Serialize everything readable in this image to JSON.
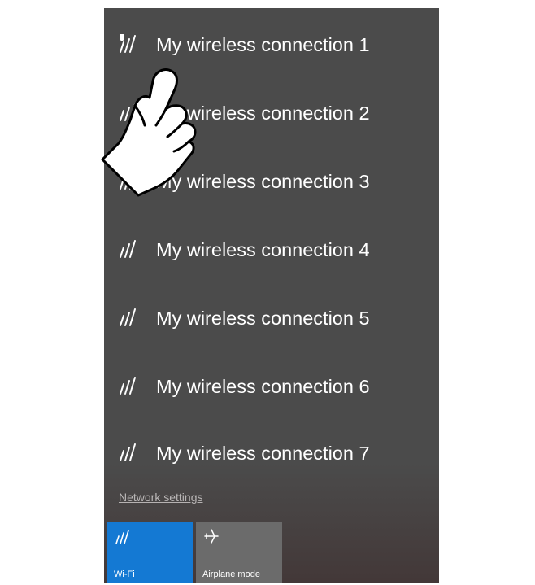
{
  "networks": [
    {
      "label": "My wireless connection 1",
      "icon": "wifi-secured-icon"
    },
    {
      "label": "My wireless connection 2",
      "icon": "wifi-icon"
    },
    {
      "label": "My wireless connection 3",
      "icon": "wifi-icon"
    },
    {
      "label": "My wireless connection 4",
      "icon": "wifi-icon"
    },
    {
      "label": "My wireless connection 5",
      "icon": "wifi-icon"
    },
    {
      "label": "My wireless connection 6",
      "icon": "wifi-icon"
    },
    {
      "label": "My wireless connection 7",
      "icon": "wifi-icon"
    }
  ],
  "settings_link": "Network settings",
  "quick_actions": {
    "wifi": {
      "label": "Wi-Fi",
      "icon": "wifi-icon",
      "active": true
    },
    "airplane": {
      "label": "Airplane mode",
      "icon": "airplane-icon",
      "active": false
    }
  },
  "overlay": {
    "icon": "pointing-hand-icon"
  },
  "colors": {
    "panel_bg": "#4b4b4b",
    "text": "#ffffff",
    "wifi_tile_bg": "#1479d3",
    "airplane_tile_bg": "#6b6b6b",
    "link_text": "#d0d0d0"
  }
}
